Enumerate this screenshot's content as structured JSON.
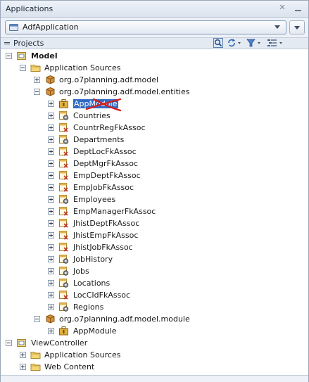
{
  "panel": {
    "title": "Applications"
  },
  "application": {
    "selected": "AdfApplication"
  },
  "projects": {
    "title": "Projects"
  },
  "tree": [
    {
      "label": "Model",
      "depth": 0,
      "icon": "project",
      "toggle": "minus",
      "bold": true
    },
    {
      "label": "Application Sources",
      "depth": 1,
      "icon": "folder",
      "toggle": "minus"
    },
    {
      "label": "org.o7planning.adf.model",
      "depth": 2,
      "icon": "package",
      "toggle": "plus"
    },
    {
      "label": "org.o7planning.adf.model.entities",
      "depth": 2,
      "icon": "package",
      "toggle": "minus"
    },
    {
      "label": "AppModule",
      "depth": 3,
      "icon": "appmodule",
      "toggle": "plus",
      "selected": true,
      "struck": true
    },
    {
      "label": "Countries",
      "depth": 3,
      "icon": "entity",
      "toggle": "plus"
    },
    {
      "label": "CountrRegFkAssoc",
      "depth": 3,
      "icon": "assoc",
      "toggle": "plus"
    },
    {
      "label": "Departments",
      "depth": 3,
      "icon": "entity",
      "toggle": "plus"
    },
    {
      "label": "DeptLocFkAssoc",
      "depth": 3,
      "icon": "assoc",
      "toggle": "plus"
    },
    {
      "label": "DeptMgrFkAssoc",
      "depth": 3,
      "icon": "assoc",
      "toggle": "plus"
    },
    {
      "label": "EmpDeptFkAssoc",
      "depth": 3,
      "icon": "assoc",
      "toggle": "plus"
    },
    {
      "label": "EmpJobFkAssoc",
      "depth": 3,
      "icon": "assoc",
      "toggle": "plus"
    },
    {
      "label": "Employees",
      "depth": 3,
      "icon": "entity",
      "toggle": "plus"
    },
    {
      "label": "EmpManagerFkAssoc",
      "depth": 3,
      "icon": "assoc",
      "toggle": "plus"
    },
    {
      "label": "JhistDeptFkAssoc",
      "depth": 3,
      "icon": "assoc",
      "toggle": "plus"
    },
    {
      "label": "JhistEmpFkAssoc",
      "depth": 3,
      "icon": "assoc",
      "toggle": "plus"
    },
    {
      "label": "JhistJobFkAssoc",
      "depth": 3,
      "icon": "assoc",
      "toggle": "plus"
    },
    {
      "label": "JobHistory",
      "depth": 3,
      "icon": "entity",
      "toggle": "plus"
    },
    {
      "label": "Jobs",
      "depth": 3,
      "icon": "entity",
      "toggle": "plus"
    },
    {
      "label": "Locations",
      "depth": 3,
      "icon": "entity",
      "toggle": "plus"
    },
    {
      "label": "LocCIdFkAssoc",
      "depth": 3,
      "icon": "assoc",
      "toggle": "plus"
    },
    {
      "label": "Regions",
      "depth": 3,
      "icon": "entity",
      "toggle": "plus"
    },
    {
      "label": "org.o7planning.adf.model.module",
      "depth": 2,
      "icon": "package",
      "toggle": "minus"
    },
    {
      "label": "AppModule",
      "depth": 3,
      "icon": "appmodule",
      "toggle": "plus"
    },
    {
      "label": "ViewController",
      "depth": 0,
      "icon": "project",
      "toggle": "minus"
    },
    {
      "label": "Application Sources",
      "depth": 1,
      "icon": "folder",
      "toggle": "plus"
    },
    {
      "label": "Web Content",
      "depth": 1,
      "icon": "folder",
      "toggle": "plus"
    }
  ],
  "colors": {
    "selection": "#316ac5",
    "folder": "#e8c45a",
    "package": "#b8741f",
    "strike": "#d42020"
  }
}
